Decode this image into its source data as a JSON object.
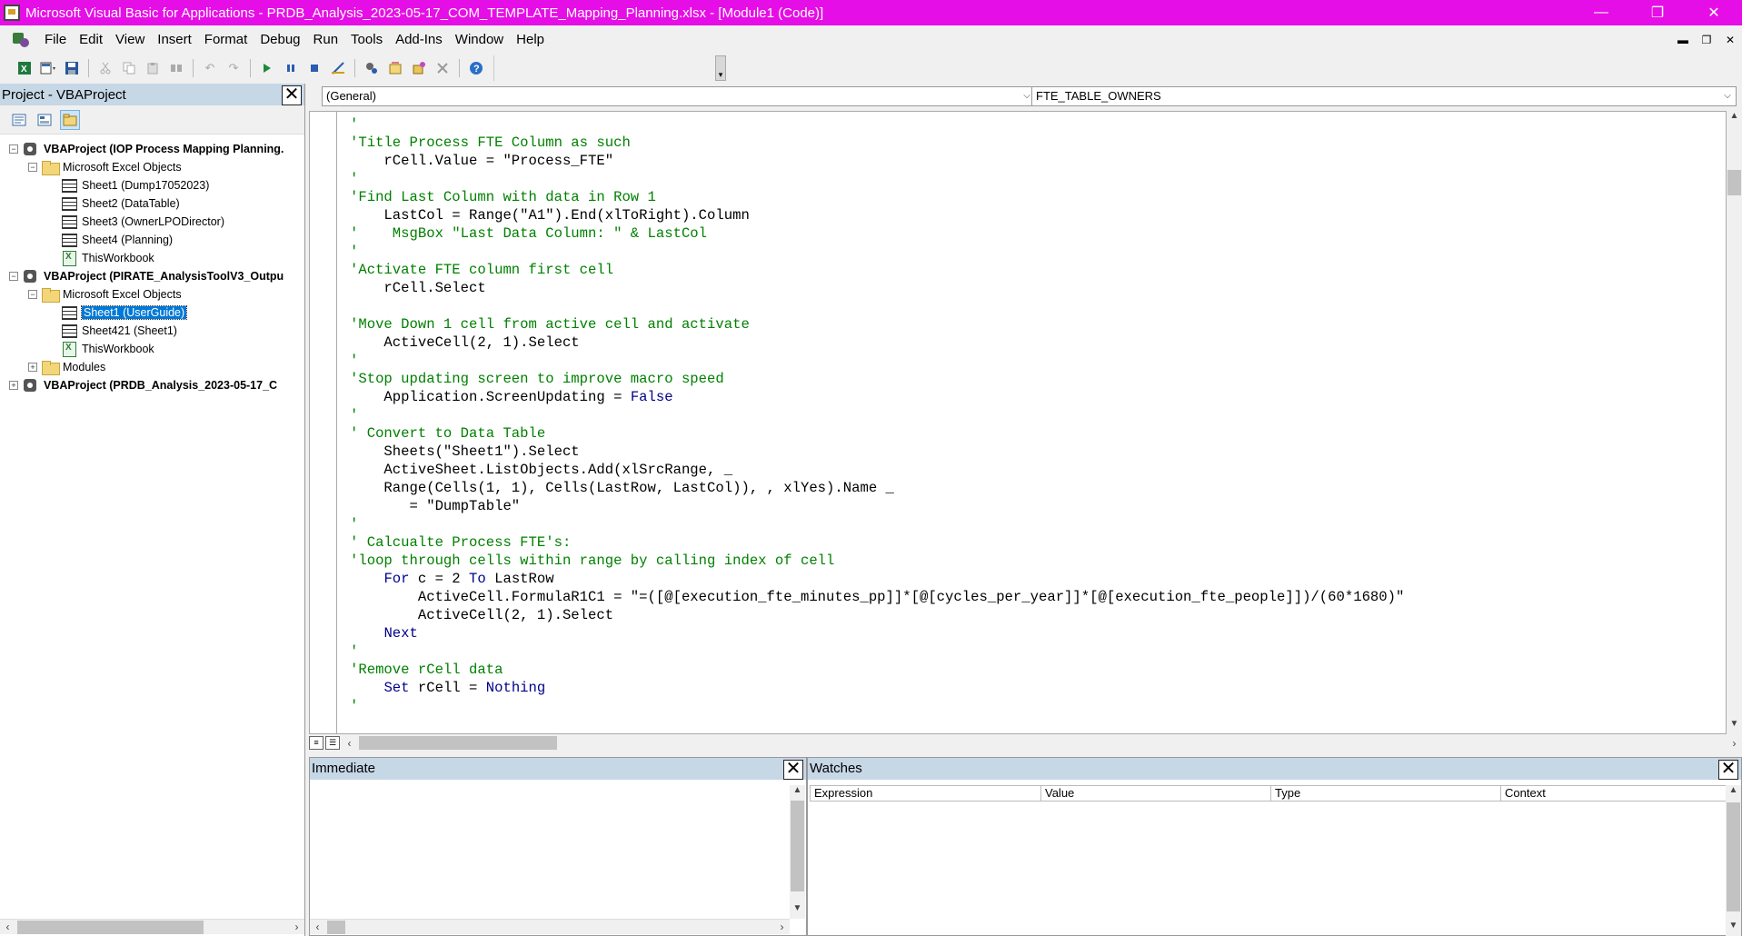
{
  "window": {
    "title": "Microsoft Visual Basic for Applications - PRDB_Analysis_2023-05-17_COM_TEMPLATE_Mapping_Planning.xlsx - [Module1 (Code)]",
    "minimize": "—",
    "restore": "❐",
    "close": "✕"
  },
  "menu": [
    "File",
    "Edit",
    "View",
    "Insert",
    "Format",
    "Debug",
    "Run",
    "Tools",
    "Add-Ins",
    "Window",
    "Help"
  ],
  "mdi_buttons": [
    "▬",
    "❐",
    "✕"
  ],
  "project": {
    "title": "Project - VBAProject",
    "nodes": [
      {
        "level": 0,
        "expander": "−",
        "icon": "vba-project-icon",
        "label": "VBAProject (IOP Process Mapping Planning.",
        "bold": true
      },
      {
        "level": 1,
        "expander": "−",
        "icon": "folder-icon",
        "label": "Microsoft Excel Objects",
        "bold": false
      },
      {
        "level": 2,
        "expander": "",
        "icon": "sheet-icon",
        "label": "Sheet1 (Dump17052023)",
        "bold": false
      },
      {
        "level": 2,
        "expander": "",
        "icon": "sheet-icon",
        "label": "Sheet2 (DataTable)",
        "bold": false
      },
      {
        "level": 2,
        "expander": "",
        "icon": "sheet-icon",
        "label": "Sheet3 (OwnerLPODirector)",
        "bold": false
      },
      {
        "level": 2,
        "expander": "",
        "icon": "sheet-icon",
        "label": "Sheet4 (Planning)",
        "bold": false
      },
      {
        "level": 2,
        "expander": "",
        "icon": "workbook-icon",
        "label": "ThisWorkbook",
        "bold": false
      },
      {
        "level": 0,
        "expander": "−",
        "icon": "vba-project-icon",
        "label": "VBAProject (PIRATE_AnalysisToolV3_Outpu",
        "bold": true
      },
      {
        "level": 1,
        "expander": "−",
        "icon": "folder-icon",
        "label": "Microsoft Excel Objects",
        "bold": false
      },
      {
        "level": 2,
        "expander": "",
        "icon": "sheet-icon",
        "label": "Sheet1 (UserGuide)",
        "bold": false,
        "selected": true
      },
      {
        "level": 2,
        "expander": "",
        "icon": "sheet-icon",
        "label": "Sheet421 (Sheet1)",
        "bold": false
      },
      {
        "level": 2,
        "expander": "",
        "icon": "workbook-icon",
        "label": "ThisWorkbook",
        "bold": false
      },
      {
        "level": 1,
        "expander": "+",
        "icon": "folder-icon",
        "label": "Modules",
        "bold": false
      },
      {
        "level": 0,
        "expander": "+",
        "icon": "vba-project-icon",
        "label": "VBAProject (PRDB_Analysis_2023-05-17_C",
        "bold": true
      }
    ]
  },
  "code": {
    "object_combo": "(General)",
    "procedure_combo": "FTE_TABLE_OWNERS",
    "lines": [
      [
        {
          "t": "'",
          "c": "cm"
        }
      ],
      [
        {
          "t": "'Title Process FTE Column as such",
          "c": "cm"
        }
      ],
      [
        {
          "t": "    rCell.Value = \"Process_FTE\"",
          "c": "tx"
        }
      ],
      [
        {
          "t": "'",
          "c": "cm"
        }
      ],
      [
        {
          "t": "'Find Last Column with data in Row 1",
          "c": "cm"
        }
      ],
      [
        {
          "t": "    LastCol = Range(\"A1\").End(xlToRight).Column",
          "c": "tx"
        }
      ],
      [
        {
          "t": "'    MsgBox \"Last Data Column: \" & LastCol",
          "c": "cm"
        }
      ],
      [
        {
          "t": "'",
          "c": "cm"
        }
      ],
      [
        {
          "t": "'Activate FTE column first cell",
          "c": "cm"
        }
      ],
      [
        {
          "t": "    rCell.Select",
          "c": "tx"
        }
      ],
      [
        {
          "t": "",
          "c": "tx"
        }
      ],
      [
        {
          "t": "'Move Down 1 cell from active cell and activate",
          "c": "cm"
        }
      ],
      [
        {
          "t": "    ActiveCell(2, 1).Select",
          "c": "tx"
        }
      ],
      [
        {
          "t": "'",
          "c": "cm"
        }
      ],
      [
        {
          "t": "'Stop updating screen to improve macro speed",
          "c": "cm"
        }
      ],
      [
        {
          "t": "    Application.ScreenUpdating = ",
          "c": "tx"
        },
        {
          "t": "False",
          "c": "kw"
        }
      ],
      [
        {
          "t": "'",
          "c": "cm"
        }
      ],
      [
        {
          "t": "' Convert to Data Table",
          "c": "cm"
        }
      ],
      [
        {
          "t": "    Sheets(\"Sheet1\").Select",
          "c": "tx"
        }
      ],
      [
        {
          "t": "    ActiveSheet.ListObjects.Add(xlSrcRange, _",
          "c": "tx"
        }
      ],
      [
        {
          "t": "    Range(Cells(1, 1), Cells(LastRow, LastCol)), , xlYes).Name _",
          "c": "tx"
        }
      ],
      [
        {
          "t": "       = \"DumpTable\"",
          "c": "tx"
        }
      ],
      [
        {
          "t": "'",
          "c": "cm"
        }
      ],
      [
        {
          "t": "' Calcualte Process FTE's:",
          "c": "cm"
        }
      ],
      [
        {
          "t": "'loop through cells within range by calling index of cell",
          "c": "cm"
        }
      ],
      [
        {
          "t": "    ",
          "c": "tx"
        },
        {
          "t": "For",
          "c": "kw"
        },
        {
          "t": " c = 2 ",
          "c": "tx"
        },
        {
          "t": "To",
          "c": "kw"
        },
        {
          "t": " LastRow",
          "c": "tx"
        }
      ],
      [
        {
          "t": "        ActiveCell.FormulaR1C1 = \"=([@[execution_fte_minutes_pp]]*[@[cycles_per_year]]*[@[execution_fte_people]])/(60*1680)\"",
          "c": "tx"
        }
      ],
      [
        {
          "t": "        ActiveCell(2, 1).Select",
          "c": "tx"
        }
      ],
      [
        {
          "t": "    ",
          "c": "tx"
        },
        {
          "t": "Next",
          "c": "kw"
        }
      ],
      [
        {
          "t": "'",
          "c": "cm"
        }
      ],
      [
        {
          "t": "'Remove rCell data",
          "c": "cm"
        }
      ],
      [
        {
          "t": "    ",
          "c": "tx"
        },
        {
          "t": "Set",
          "c": "kw"
        },
        {
          "t": " rCell = ",
          "c": "tx"
        },
        {
          "t": "Nothing",
          "c": "kw"
        }
      ],
      [
        {
          "t": "'",
          "c": "cm"
        }
      ]
    ]
  },
  "immediate": {
    "title": "Immediate"
  },
  "watches": {
    "title": "Watches",
    "columns": [
      "Expression",
      "Value",
      "Type",
      "Context"
    ]
  }
}
